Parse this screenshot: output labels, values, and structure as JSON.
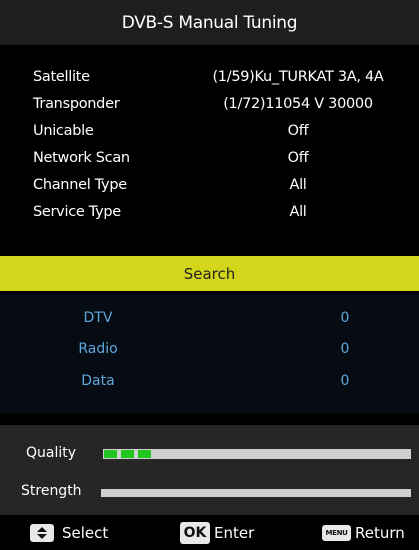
{
  "header": {
    "title": "DVB-S Manual Tuning"
  },
  "settings": [
    {
      "label": "Satellite",
      "value": "(1/59)Ku_TURKAT 3A, 4A"
    },
    {
      "label": "Transponder",
      "value": "(1/72)11054 V 30000"
    },
    {
      "label": "Unicable",
      "value": "Off"
    },
    {
      "label": "Network Scan",
      "value": "Off"
    },
    {
      "label": "Channel Type",
      "value": "All"
    },
    {
      "label": "Service Type",
      "value": "All"
    }
  ],
  "search": {
    "label": "Search"
  },
  "results": [
    {
      "label": "DTV",
      "count": "0"
    },
    {
      "label": "Radio",
      "count": "0"
    },
    {
      "label": "Data",
      "count": "0"
    }
  ],
  "signal": {
    "quality_label": "Quality",
    "quality_level_segments": 3,
    "strength_label": "Strength",
    "strength_level": 0
  },
  "footer": {
    "select_label": "Select",
    "ok_key": "OK",
    "enter_label": "Enter",
    "menu_key": "MENU",
    "return_label": "Return"
  },
  "colors": {
    "highlight": "#d4d61c",
    "result_text": "#5ea7dc",
    "quality_fill": "#22c522"
  }
}
